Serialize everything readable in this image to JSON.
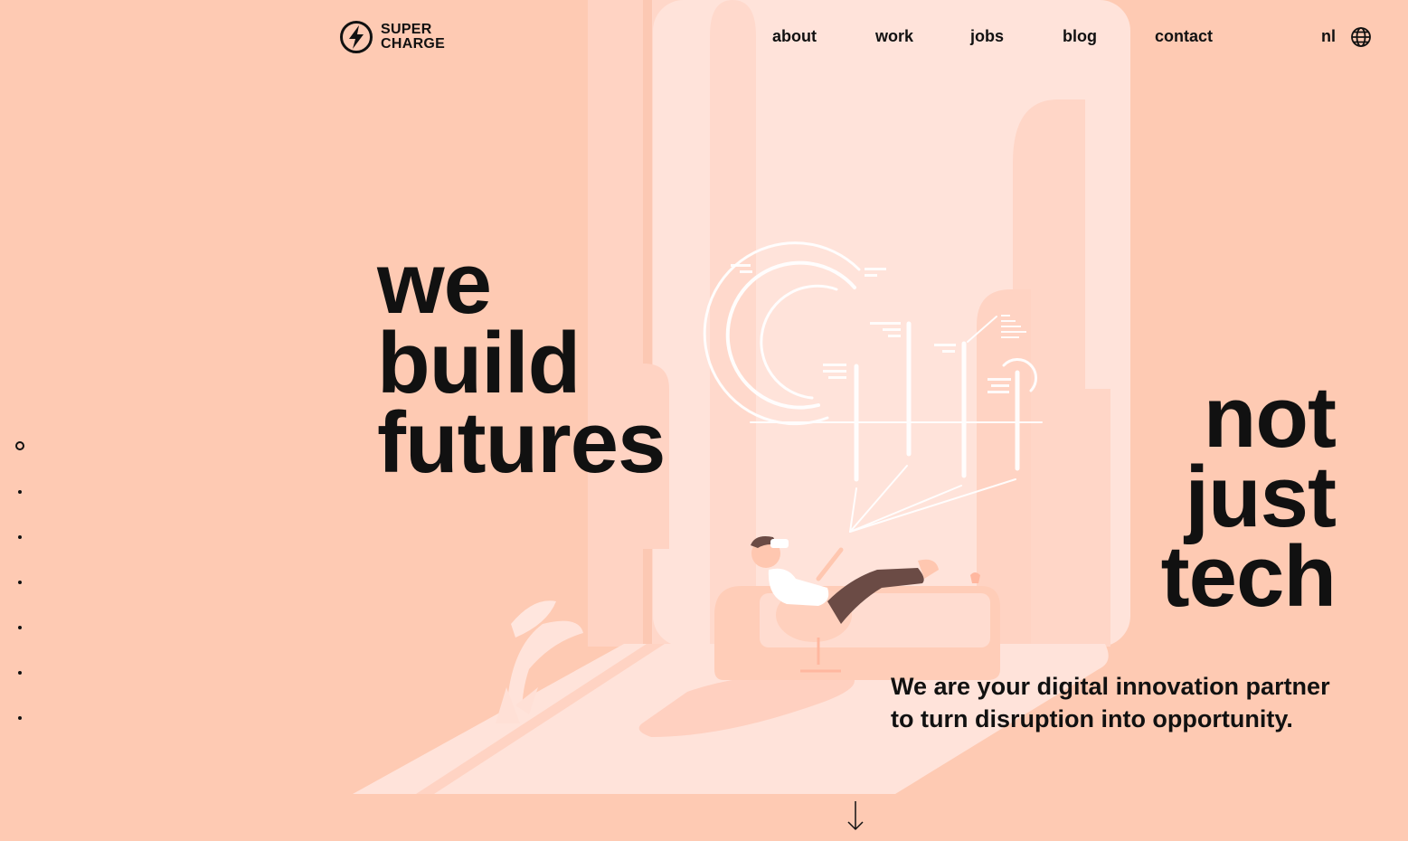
{
  "brand": {
    "name_line1": "SUPER",
    "name_line2": "CHARGE",
    "logo_icon": "lightning-bolt-circle-icon"
  },
  "nav": {
    "items": [
      "about",
      "work",
      "jobs",
      "blog",
      "contact"
    ],
    "language": "nl",
    "language_icon": "globe-icon"
  },
  "hero": {
    "headline_left": [
      "we",
      "build",
      "futures"
    ],
    "headline_right": [
      "not",
      "just",
      "tech"
    ],
    "tagline_line1": "We are your digital innovation partner",
    "tagline_line2": "to turn disruption into opportunity."
  },
  "pagination": {
    "count": 7,
    "active_index": 0
  },
  "scroll_icon": "arrow-down-icon",
  "colors": {
    "background": "#fecab3",
    "light_panel": "#ffe3da",
    "mid_panel": "#ffd5c6",
    "text": "#111111",
    "person_pants": "#6b4b45",
    "holo_white": "#ffffff"
  }
}
